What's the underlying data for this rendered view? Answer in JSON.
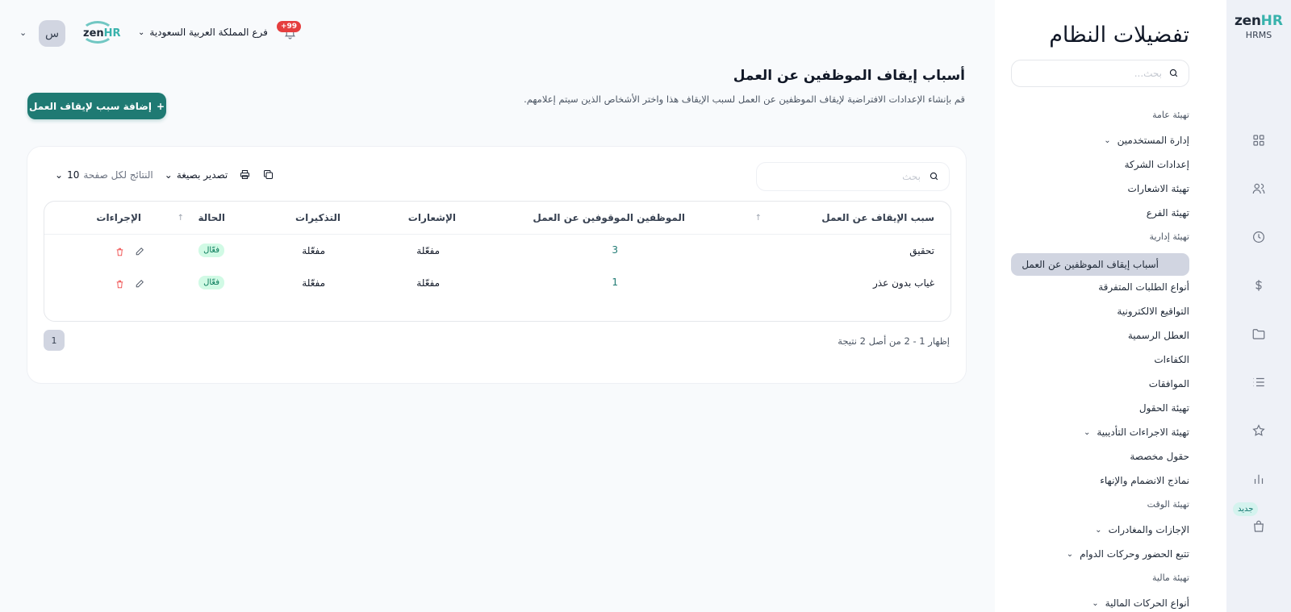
{
  "brand": {
    "zen": "zen",
    "hr": "HR",
    "product": "HRMS"
  },
  "rail": {
    "icons": [
      "grid-icon",
      "users-icon",
      "clock-icon",
      "dollar-icon",
      "folder-icon",
      "list-icon",
      "star-icon",
      "chart-icon",
      "bag-icon"
    ],
    "new_badge": "جديد"
  },
  "sidebar": {
    "title": "تفضيلات النظام",
    "search_placeholder": "بحث...",
    "sections": {
      "general": "تهيئة عامة",
      "admin": "تهيئة إدارية",
      "time": "تهيئة الوقت",
      "finance": "تهيئة مالية"
    },
    "items": {
      "user_mgmt": "إدارة المستخدمين",
      "company_settings": "إعدادات الشركة",
      "notifications_setup": "تهيئة الاشعارات",
      "branch_setup": "تهيئة الفرع",
      "suspension_reasons": "أسباب إيقاف الموظفين عن العمل",
      "misc_requests": "أنواع الطلبات المتفرقة",
      "e_signatures": "التواقيع الالكترونية",
      "holidays": "العطل الرسمية",
      "competencies": "الكفاءات",
      "approvals": "الموافقات",
      "fields_setup": "تهيئة الحقول",
      "disciplinary": "تهيئة الاجراءات التأديبية",
      "custom_fields": "حقول مخصصة",
      "onboarding": "نماذج الانضمام والإنهاء",
      "leaves": "الإجازات والمغادرات",
      "attendance": "تتبع الحضور وحركات الدوام",
      "financial_types": "أنواع الحركات المالية"
    }
  },
  "header": {
    "notif_count": "+99",
    "branch": "فرع المملكة العربية السعودية",
    "avatar_initial": "س"
  },
  "page": {
    "title": "أسباب إيقاف الموظفين عن العمل",
    "description": "قم بإنشاء الإعدادات الافتراضية لإيقاف الموظفين عن العمل لسبب الإيقاف هذا واختر الأشخاص الذين سيتم إعلامهم.",
    "add_button": "إضافة سبب لإيقاف العمل"
  },
  "table": {
    "search_placeholder": "بحث",
    "per_page_label": "النتائج لكل صفحة",
    "per_page_value": "10",
    "export_label": "تصدير بصيغة",
    "columns": {
      "reason": "سبب الإيقاف عن العمل",
      "suspended": "الموظفين الموقوفين عن العمل",
      "notifications": "الإشعارات",
      "reminders": "التذكيرات",
      "status": "الحالة",
      "actions": "الإجراءات"
    },
    "rows": [
      {
        "reason": "تحقيق",
        "suspended": "3",
        "notifications": "مفعّلة",
        "reminders": "مفعّلة",
        "status": "فعّال"
      },
      {
        "reason": "غياب بدون عذر",
        "suspended": "1",
        "notifications": "مفعّلة",
        "reminders": "مفعّلة",
        "status": "فعّال"
      }
    ],
    "page_info": "إظهار 1 - 2 من أصل 2 نتيجة",
    "current_page": "1"
  }
}
